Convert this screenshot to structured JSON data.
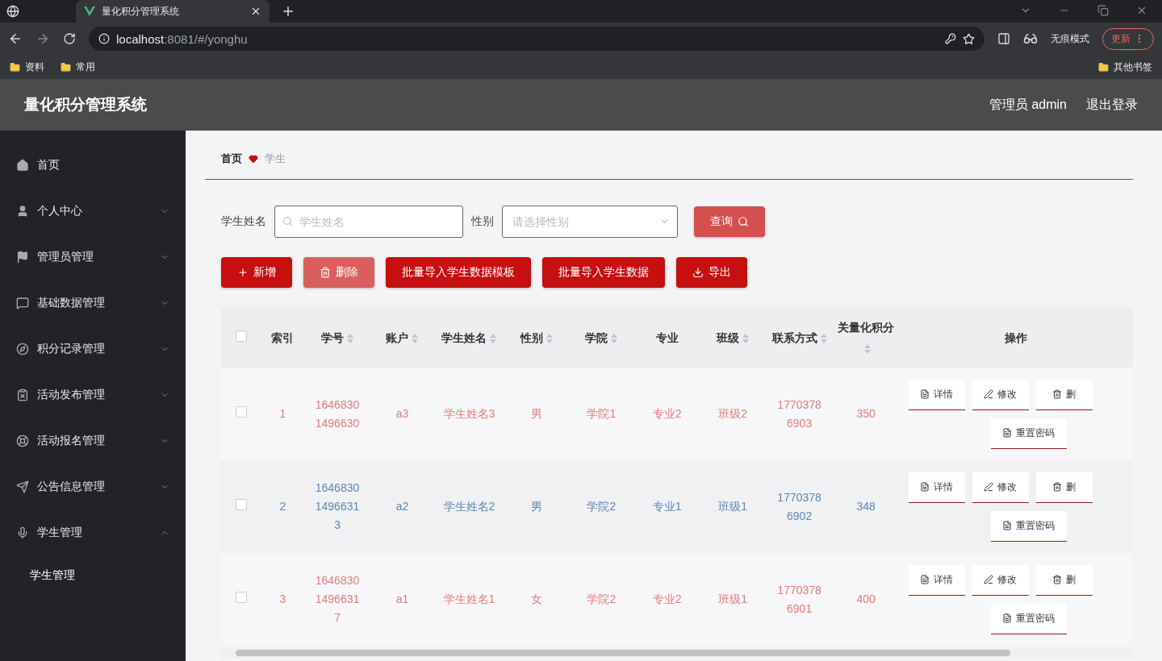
{
  "browser": {
    "tab_title": "量化积分管理系统",
    "url_host": "localhost",
    "url_path": ":8081/#/yonghu",
    "incognito_label": "无痕模式",
    "update_button": "更新",
    "bookmarks": [
      "资料",
      "常用"
    ],
    "other_bookmarks": "其他书签"
  },
  "header": {
    "title": "量化积分管理系统",
    "user": "管理员 admin",
    "logout": "退出登录"
  },
  "sidebar": {
    "items": [
      {
        "label": "首页"
      },
      {
        "label": "个人中心",
        "expanded": false
      },
      {
        "label": "管理员管理",
        "expanded": false
      },
      {
        "label": "基础数据管理",
        "expanded": false
      },
      {
        "label": "积分记录管理",
        "expanded": false
      },
      {
        "label": "活动发布管理",
        "expanded": false
      },
      {
        "label": "活动报名管理",
        "expanded": false
      },
      {
        "label": "公告信息管理",
        "expanded": false
      },
      {
        "label": "学生管理",
        "expanded": true,
        "children": [
          {
            "label": "学生管理"
          }
        ]
      }
    ]
  },
  "breadcrumb": [
    "首页",
    "学生"
  ],
  "search": {
    "name_label": "学生姓名",
    "name_placeholder": "学生姓名",
    "gender_label": "性别",
    "gender_placeholder": "请选择性别",
    "query_button": "查询"
  },
  "actions": [
    {
      "label": "新增",
      "kind": "add",
      "disabled": false
    },
    {
      "label": "删除",
      "kind": "delete",
      "disabled": true
    },
    {
      "label": "批量导入学生数据模板",
      "kind": "plain",
      "disabled": false
    },
    {
      "label": "批量导入学生数据",
      "kind": "plain",
      "disabled": false
    },
    {
      "label": "导出",
      "kind": "export",
      "disabled": false
    }
  ],
  "table": {
    "columns": [
      {
        "label": "索引",
        "sortable": false
      },
      {
        "label": "学号",
        "sortable": true
      },
      {
        "label": "账户",
        "sortable": true
      },
      {
        "label": "学生姓名",
        "sortable": true
      },
      {
        "label": "性别",
        "sortable": true
      },
      {
        "label": "学院",
        "sortable": true
      },
      {
        "label": "专业",
        "sortable": false
      },
      {
        "label": "班级",
        "sortable": true
      },
      {
        "label": "联系方式",
        "sortable": true
      },
      {
        "label": "关量化积分",
        "sortable": true
      },
      {
        "label": "操作",
        "sortable": false
      }
    ],
    "select_all_checked": false,
    "rows": [
      {
        "checked": false,
        "cells": [
          "1",
          "16468301496630",
          "a3",
          "学生姓名3",
          "男",
          "学院1",
          "专业2",
          "班级2",
          "17703786903",
          "350"
        ],
        "actions": [
          "详情",
          "修改",
          "删",
          "重置密码"
        ]
      },
      {
        "checked": false,
        "cells": [
          "2",
          "164683014966313",
          "a2",
          "学生姓名2",
          "男",
          "学院2",
          "专业1",
          "班级1",
          "17703786902",
          "348"
        ],
        "actions": [
          "详情",
          "修改",
          "删",
          "重置密码"
        ]
      },
      {
        "checked": false,
        "cells": [
          "3",
          "164683014966317",
          "a1",
          "学生姓名1",
          "女",
          "学院2",
          "专业2",
          "班级1",
          "17703786901",
          "400"
        ],
        "actions": [
          "详情",
          "修改",
          "删",
          "重置密码"
        ]
      }
    ]
  }
}
